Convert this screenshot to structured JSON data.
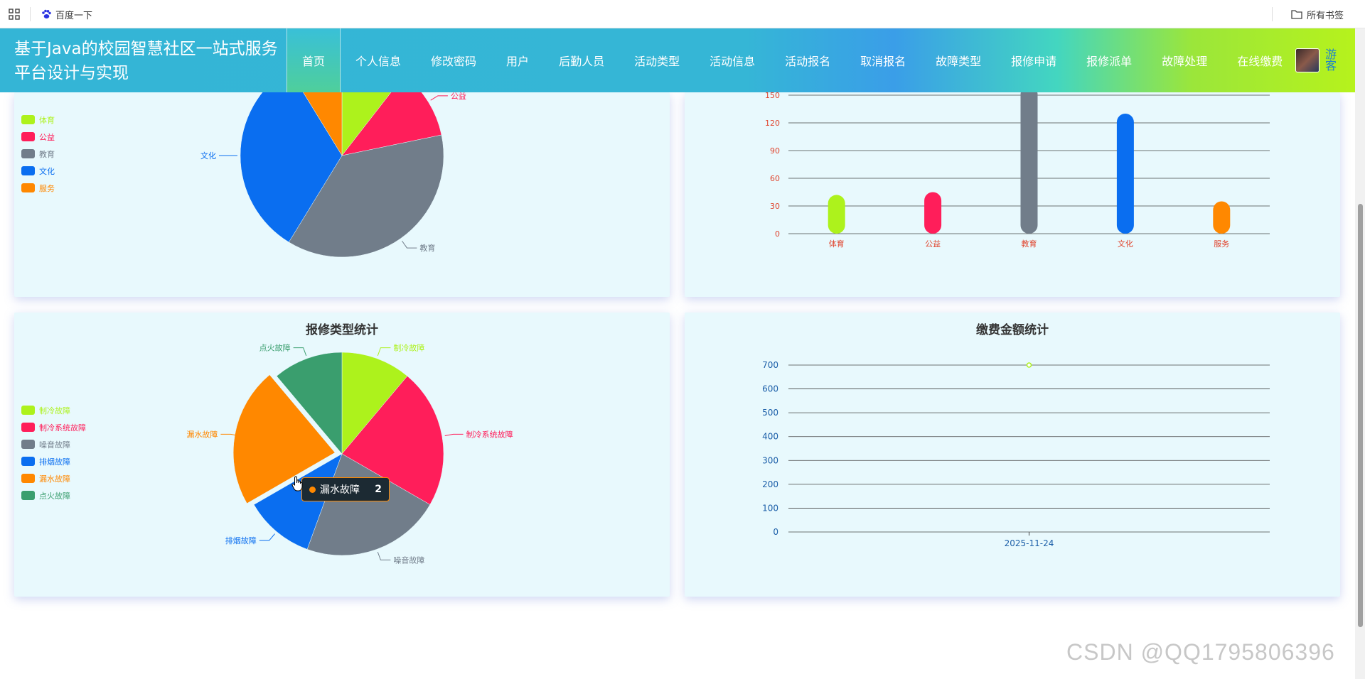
{
  "bookmarks": {
    "item": "百度一下",
    "all": "所有书签"
  },
  "header": {
    "title": "基于Java的校园智慧社区一站式服务平台设计与实现",
    "nav": [
      "首页",
      "个人信息",
      "修改密码",
      "用户",
      "后勤人员",
      "活动类型",
      "活动信息",
      "活动报名",
      "取消报名",
      "故障类型",
      "报修申请",
      "报修派单",
      "故障处理",
      "在线缴费"
    ],
    "active_index": 0,
    "guest": "游客"
  },
  "colors": [
    "#adf21c",
    "#ff1e5a",
    "#717d8a",
    "#0a6ef0",
    "#ff8800",
    "#3a9e6e"
  ],
  "panels": {
    "activity_pie": {
      "title": ""
    },
    "activity_bar": {
      "title": ""
    },
    "repair_pie": {
      "title": "报修类型统计"
    },
    "payment_line": {
      "title": "缴费金额统计"
    }
  },
  "tooltip": {
    "label": "漏水故障",
    "value": "2"
  },
  "watermark": "CSDN @QQ1795806396",
  "chart_data": [
    {
      "type": "pie",
      "categories": [
        "体育",
        "公益",
        "教育",
        "文化",
        "服务"
      ],
      "values": [
        42,
        45,
        148,
        130,
        35
      ],
      "legend": "left"
    },
    {
      "type": "bar",
      "categories": [
        "体育",
        "公益",
        "教育",
        "文化",
        "服务"
      ],
      "values": [
        42,
        45,
        160,
        130,
        35
      ],
      "ylim": [
        0,
        150
      ],
      "yticks": [
        0,
        30,
        60,
        90,
        120,
        150
      ],
      "grid": true
    },
    {
      "type": "pie",
      "title": "报修类型统计",
      "categories": [
        "制冷故障",
        "制冷系统故障",
        "噪音故障",
        "排烟故障",
        "漏水故障",
        "点火故障"
      ],
      "values": [
        1,
        2,
        2,
        1,
        2,
        1
      ],
      "legend": "left"
    },
    {
      "type": "line",
      "title": "缴费金额统计",
      "x": [
        "2025-11-24"
      ],
      "values": [
        700
      ],
      "ylim": [
        0,
        700
      ],
      "yticks": [
        0,
        100,
        200,
        300,
        400,
        500,
        600,
        700
      ],
      "grid": true
    }
  ]
}
